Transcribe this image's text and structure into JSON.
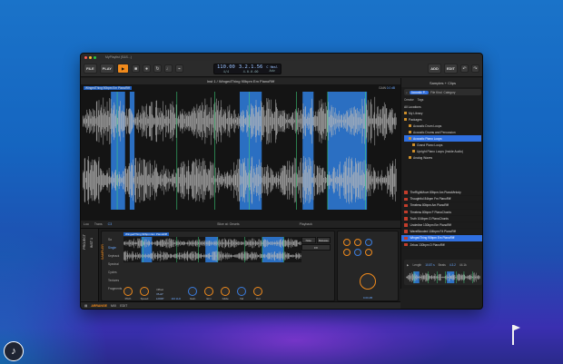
{
  "window": {
    "title": "MyPlaylist (S&S...)"
  },
  "toolbar": {
    "file": "FILE",
    "play": "PLAY",
    "tempo": "110.00",
    "time_sig": "4/4",
    "position": "3.2.1.56",
    "position2": "4.0.0.00",
    "add": "ADD",
    "edit": "EDIT",
    "key_label": "C Hmsl",
    "key_sub": "Adv"
  },
  "editor": {
    "header": "Inst 1 / WingedThing 90bpm Em PianoRiff",
    "clip_label": "WingedThing 90bpm Em PianoRiff",
    "gain_label": "GAIN",
    "gain_value": "0.0 dB",
    "foot_left": "Loo",
    "foot_trans": "Trans",
    "foot_trans_val": "C3",
    "foot_slice": "Slice at: Onsets",
    "foot_playback": "Playback"
  },
  "browser": {
    "title": "Samples + Clips",
    "search_pill": "Acoustic P...",
    "file_kind": "File Kind",
    "category": "Category",
    "creator": "Creator",
    "tags": "Tags",
    "locations": [
      {
        "label": "All Locations"
      },
      {
        "label": "My Library"
      },
      {
        "label": "Packages"
      },
      {
        "label": "Acoustic Drum Loops"
      },
      {
        "label": "Acoustic Drums and Percussion"
      },
      {
        "label": "Acoustic Piano Loops"
      },
      {
        "label": "Grand Piano Loops"
      },
      {
        "label": "Upright Piano Loops (Inside Audio)"
      },
      {
        "label": "Analog Waves"
      }
    ],
    "results": [
      {
        "label": "TheRightMove 80bpm Am PianoMelody"
      },
      {
        "label": "Thoughtful 84bpm Fm PianoRiff"
      },
      {
        "label": "Timeless 80bpm Am PianoRiff"
      },
      {
        "label": "Timeless 80bpm F PianoChords"
      },
      {
        "label": "Truth 104bpm G PianoChords"
      },
      {
        "label": "Underline 130bpm Em PianoRiff"
      },
      {
        "label": "WaveBlooded 104bpm F# PianoRiff"
      },
      {
        "label": "WingedThing 90bpm Em PianoRiff"
      },
      {
        "label": "Zekus 130bpm D PianoRiff"
      }
    ],
    "preview": {
      "length_label": "Length",
      "length_value": "10.87 s",
      "beats_label": "Beats",
      "beats_value": "4.3.2",
      "rate_label": "44.1k"
    }
  },
  "device": {
    "strip1": "PROJECT",
    "strip2": "INST 1",
    "name": "SAMPLER",
    "modes": [
      "Sa",
      "Single",
      "Keytrack",
      "Spectral",
      "Cycles",
      "Textures",
      "Fragments"
    ],
    "mini_label": "WingedThing 90bpm Em PianoRiff",
    "note_btn": "Note",
    "release_btn": "Release",
    "fx_btn": "FX",
    "knobs": [
      {
        "label": "Pitch"
      },
      {
        "label": "Speed"
      },
      {
        "label": "Gain"
      },
      {
        "label": "Env"
      },
      {
        "label": "Glide"
      },
      {
        "label": "Vel"
      },
      {
        "label": "Out"
      }
    ],
    "offset_label": "Offset",
    "play_label": "PLAY",
    "loop_label": "LOOP",
    "freq_value": "110 kHz",
    "gain_db": "0.00 dB"
  },
  "bottom": {
    "arrange": "ARRANGE",
    "mix": "MIX",
    "edit": "EDIT"
  },
  "logo_glyph": "♪",
  "colors": {
    "accent_orange": "#f08a1c",
    "slice_blue": "#2f7fe0",
    "selection_blue": "#2f6fe0",
    "background_top": "#1a73c9",
    "background_bottom": "#3a2fb0"
  }
}
